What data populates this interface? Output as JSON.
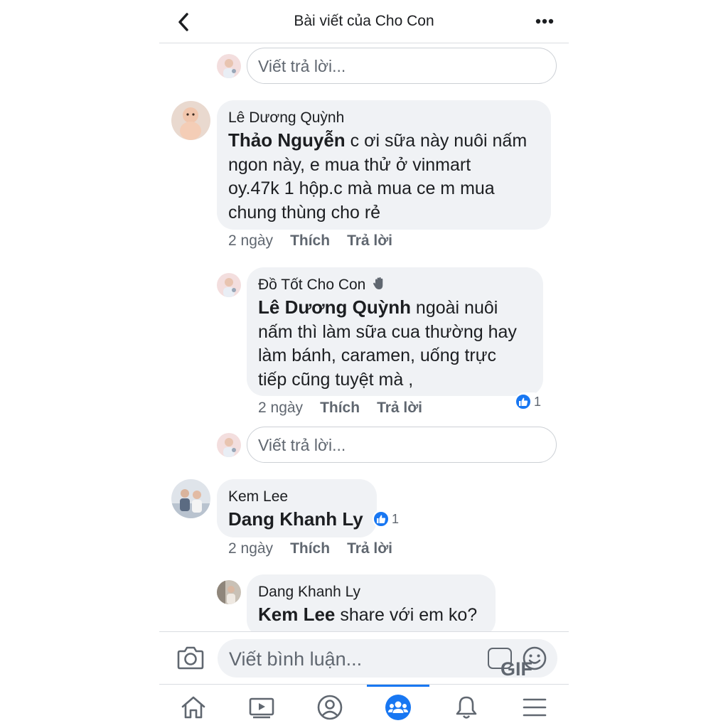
{
  "header": {
    "title": "Bài viết của Cho Con",
    "back_icon": "chevron-left-icon",
    "more_icon": "more-horizontal-icon"
  },
  "reply_placeholder_1": "Viết trả lời...",
  "comments": [
    {
      "author": "Lê Dương Quỳnh",
      "mention": "Thảo Nguyễn",
      "text_line1_rest": " c ơi sữa này nuôi nấm",
      "text_line2": "ngon này, e mua thử ở vinmart",
      "text_line3": "oy.47k 1 hộp.c mà mua ce m mua",
      "text_line4": "chung thùng cho rẻ",
      "time": "2 ngày",
      "like_label": "Thích",
      "reply_label": "Trả lời"
    },
    {
      "author": "Đồ Tốt Cho Con",
      "author_badge_icon": "wave-hand-icon",
      "mention": "Lê Dương Quỳnh",
      "text_line1_rest": " ngoài nuôi",
      "text_line2": "nấm thì làm sữa cua thường hay",
      "text_line3": "làm bánh, caramen, uống trực",
      "text_line4": "tiếp cũng tuyệt mà ,",
      "time": "2 ngày",
      "like_label": "Thích",
      "reply_label": "Trả lời",
      "reaction_count": "1"
    },
    {
      "author": "Kem Lee",
      "mention": "Dang Khanh Ly",
      "time": "2 ngày",
      "like_label": "Thích",
      "reply_label": "Trả lời",
      "reaction_count": "1"
    },
    {
      "author": "Dang Khanh Ly",
      "mention": "Kem Lee",
      "text_line1_rest": " share với em ko?"
    }
  ],
  "reply_placeholder_2": "Viết trả lời...",
  "composer": {
    "placeholder": "Viết bình luận...",
    "gif_label": "GIF",
    "camera_icon": "camera-icon",
    "emoji_icon": "smiley-icon"
  },
  "tabbar": {
    "items": [
      "home-icon",
      "video-icon",
      "profile-icon",
      "groups-icon",
      "bell-icon",
      "menu-icon"
    ],
    "active": "groups-icon",
    "accent": "#1877f2"
  }
}
